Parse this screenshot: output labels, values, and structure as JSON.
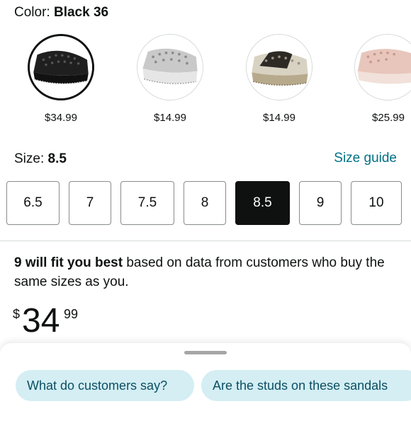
{
  "color": {
    "label": "Color:",
    "value": "Black 36"
  },
  "swatches": [
    {
      "price": "$34.99",
      "color": "#1f1f1f"
    },
    {
      "price": "$14.99",
      "color": "#c9c9c9"
    },
    {
      "price": "$14.99",
      "color": "#b7a98c"
    },
    {
      "price": "$25.99",
      "color": "#e8c6bb"
    }
  ],
  "size": {
    "label": "Size:",
    "value": "8.5",
    "guide": "Size guide"
  },
  "sizes": [
    "6.5",
    "7",
    "7.5",
    "8",
    "8.5",
    "9",
    "10"
  ],
  "selected_size": "8.5",
  "fit": {
    "bold": "9 will fit you best",
    "rest": " based on data from customers who buy the same sizes as you."
  },
  "price": {
    "currency": "$",
    "whole": "34",
    "fraction": "99"
  },
  "chips": [
    "What do customers say?",
    "Are the studs on these sandals"
  ]
}
